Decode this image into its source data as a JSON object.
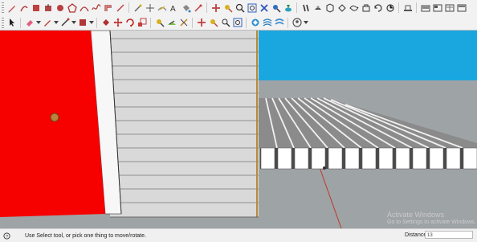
{
  "toolbar_primary": {
    "icons": [
      "pencil-icon",
      "line-icon",
      "rectangle-icon",
      "push-pull-icon",
      "circle-icon",
      "polygon-icon",
      "arc-icon",
      "freehand-icon",
      "offset-icon",
      "tape-measure-icon",
      "protractor-icon",
      "axes-icon",
      "dimension-icon",
      "text-icon",
      "paint-bucket-icon",
      "orbit-icon",
      "pan-icon",
      "zoom-icon",
      "zoom-extents-icon",
      "walk-icon",
      "position-camera-icon",
      "look-around-icon",
      "section-plane-icon",
      "display-section-icon",
      "section-fill-icon",
      "iso-view-icon",
      "top-view-icon",
      "front-view-icon",
      "right-view-icon",
      "back-view-icon",
      "left-view-icon",
      "xray-icon",
      "wireframe-icon",
      "hidden-line-icon",
      "shaded-icon",
      "textured-icon"
    ]
  },
  "toolbar_secondary": {
    "icons": [
      "select-icon",
      "eraser-icon",
      "pencil-icon",
      "line-icon",
      "rectangle-icon",
      "paint-bucket-icon",
      "move-icon",
      "rotate-icon",
      "scale-icon",
      "tape-measure-icon",
      "text-icon",
      "orbit-icon",
      "pan-icon",
      "zoom-icon",
      "zoom-window-icon",
      "previous-view-icon",
      "3d-warehouse-icon",
      "extension-warehouse-icon",
      "layout-icon",
      "user-icon"
    ]
  },
  "colors": {
    "door_red": "#f70000",
    "siding": "#d9d9d9",
    "sky": "#1aa7df",
    "ground": "#9ea3a6",
    "accent_axis": "#c0392b"
  },
  "watermark": {
    "line1": "Activate Windows",
    "line2": "Go to Settings to activate Windows."
  },
  "statusbar": {
    "hint": "Use Select tool, or pick one thing to move/rotate.",
    "measurement_label": "Distance",
    "measurement_value": "13"
  }
}
